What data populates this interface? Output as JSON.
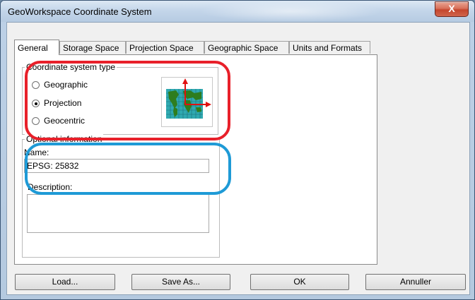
{
  "window": {
    "title": "GeoWorkspace Coordinate System",
    "close_label": "X"
  },
  "tabs": [
    {
      "label": "General",
      "active": true
    },
    {
      "label": "Storage Space",
      "active": false
    },
    {
      "label": "Projection Space",
      "active": false
    },
    {
      "label": "Geographic Space",
      "active": false
    },
    {
      "label": "Units and Formats",
      "active": false
    }
  ],
  "coordinate_type": {
    "legend": "Coordinate system type",
    "options": [
      {
        "label": "Geographic",
        "checked": false
      },
      {
        "label": "Projection",
        "checked": true
      },
      {
        "label": "Geocentric",
        "checked": false
      }
    ],
    "icon": "world-map-projection-icon"
  },
  "optional_info": {
    "legend": "Optional information",
    "name_label": "Name:",
    "name_value": "EPSG: 25832",
    "description_label": "Description:",
    "description_value": ""
  },
  "buttons": {
    "load": "Load...",
    "save_as": "Save As...",
    "ok": "OK",
    "cancel": "Annuller"
  },
  "annotation_colors": {
    "red": "#e8202a",
    "blue": "#1e9ad6"
  }
}
